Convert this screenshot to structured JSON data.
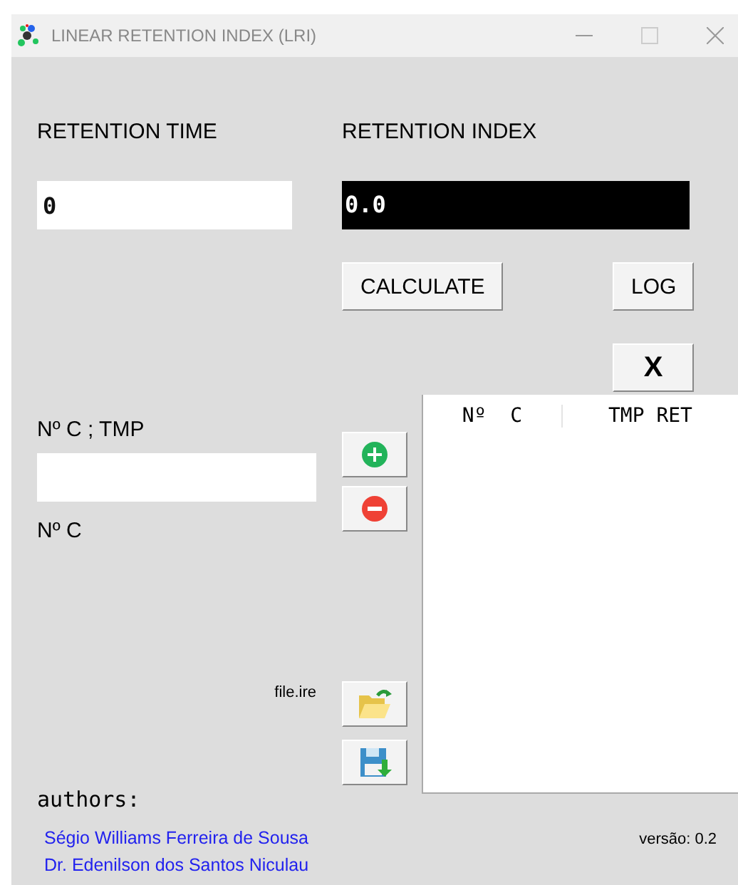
{
  "window": {
    "title": "LINEAR RETENTION INDEX (LRI)"
  },
  "retention_time": {
    "label": "RETENTION TIME",
    "value": "0"
  },
  "retention_index": {
    "label": "RETENTION INDEX",
    "value": "0.0"
  },
  "buttons": [
    {
      "label": "CALCULATE",
      "kind": "calculate"
    },
    {
      "label": "LOG",
      "kind": "log"
    },
    {
      "label": "X",
      "kind": "clear"
    }
  ],
  "entry": {
    "label": "Nº C ; TMP",
    "value_label": "Nº C"
  },
  "side_buttons": [
    {
      "kind": "add"
    },
    {
      "kind": "remove"
    },
    {
      "kind": "open"
    },
    {
      "kind": "save"
    }
  ],
  "file_label": "file.ire",
  "table": {
    "columns": [
      "Nº  C",
      "TMP RET"
    ]
  },
  "authors": {
    "label": "authors:",
    "names": [
      "Ségio Williams Ferreira de Sousa",
      "Dr. Edenilson dos Santos Niculau"
    ]
  },
  "version": "versão: 0.2"
}
